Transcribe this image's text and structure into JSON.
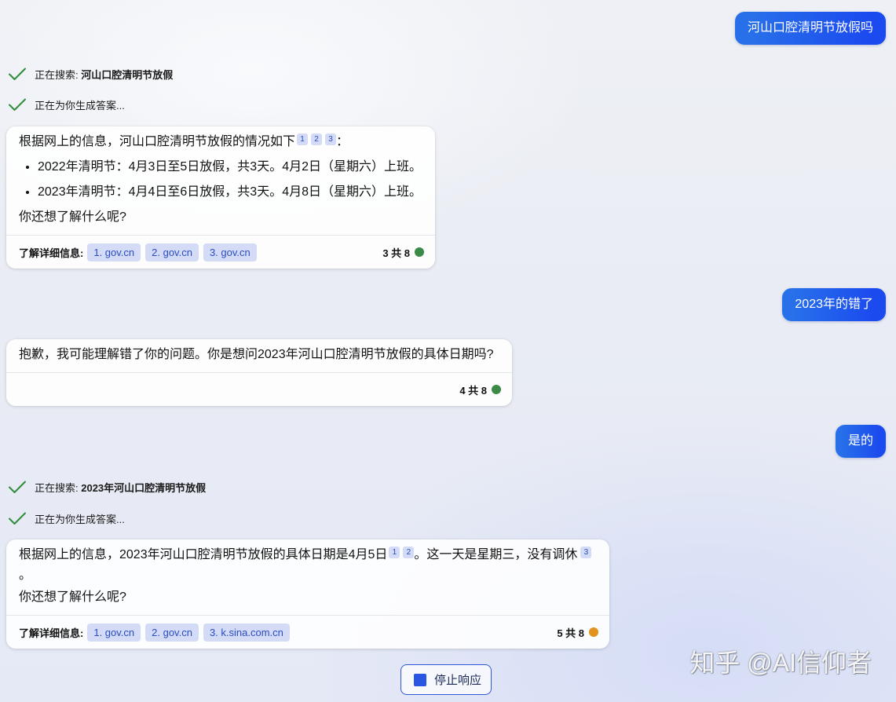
{
  "colors": {
    "user_bubble_start": "#2870ea",
    "user_bubble_end": "#1b4aef",
    "check": "#2e8b3a",
    "citation_bg": "#d3dbf6",
    "citation_text": "#2b4dbf",
    "stop_border": "#2f57d6",
    "stop_icon": "#2a55e3"
  },
  "conversation": {
    "user_1": {
      "text": "河山口腔清明节放假吗"
    },
    "status_1": {
      "icon": "check-icon",
      "label": "正在搜索: ",
      "query": "河山口腔清明节放假"
    },
    "status_2": {
      "icon": "check-icon",
      "label": "正在为你生成答案..."
    },
    "bot_1": {
      "intro": "根据网上的信息，河山口腔清明节放假的情况如下",
      "intro_citations": [
        "1",
        "2",
        "3"
      ],
      "intro_end": "：",
      "bullets": [
        "2022年清明节：4月3日至5日放假，共3天。4月2日（星期六）上班。",
        "2023年清明节：4月4日至6日放假，共3天。4月8日（星期六）上班。"
      ],
      "followup": "你还想了解什么呢?",
      "learn_more_label": "了解详细信息:",
      "sources": [
        "1. gov.cn",
        "2. gov.cn",
        "3. gov.cn"
      ],
      "counter": "3 共 8",
      "counter_dot_color": "#3b8a46"
    },
    "user_2": {
      "text": "2023年的错了"
    },
    "bot_2": {
      "text": "抱歉，我可能理解错了你的问题。你是想问2023年河山口腔清明节放假的具体日期吗?",
      "counter": "4 共 8",
      "counter_dot_color": "#3b8a46"
    },
    "user_3": {
      "text": "是的"
    },
    "status_3": {
      "icon": "check-icon",
      "label": "正在搜索: ",
      "query": "2023年河山口腔清明节放假"
    },
    "status_4": {
      "icon": "check-icon",
      "label": "正在为你生成答案..."
    },
    "bot_3": {
      "text_start": "根据网上的信息，2023年河山口腔清明节放假的具体日期是4月5日",
      "citations_a": [
        "1",
        "2"
      ],
      "text_middle": "。这一天是星期三，没有调休",
      "citations_b": [
        "3"
      ],
      "text_end": "。",
      "followup": "你还想了解什么呢?",
      "learn_more_label": "了解详细信息:",
      "sources": [
        "1. gov.cn",
        "2. gov.cn",
        "3. k.sina.com.cn"
      ],
      "counter": "5 共 8",
      "counter_dot_color": "#e2921f"
    }
  },
  "stop_button": {
    "label": "停止响应",
    "icon": "stop-square-icon"
  },
  "watermark": "知乎 @AI信仰者"
}
